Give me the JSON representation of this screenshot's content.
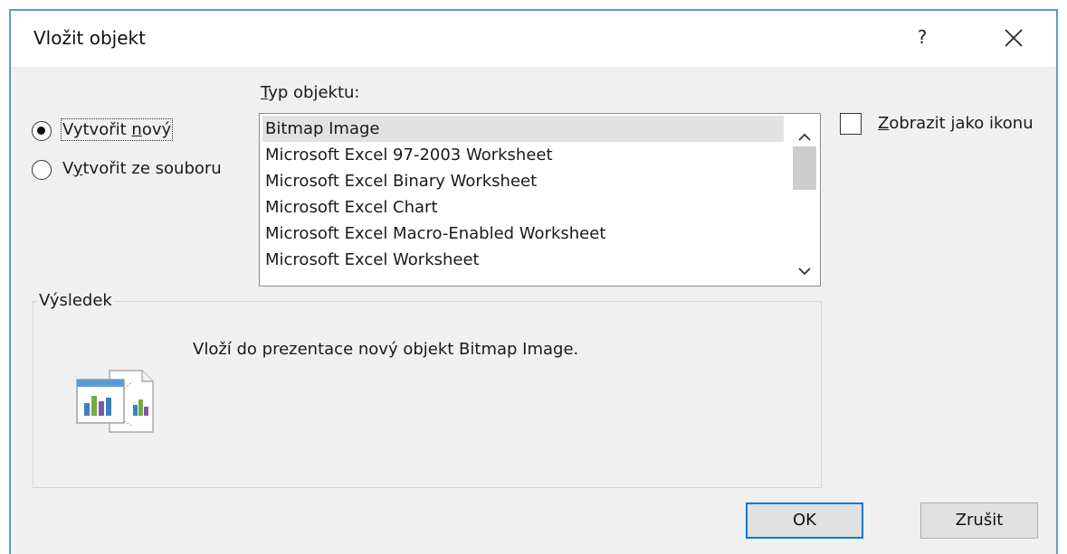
{
  "dialog": {
    "title": "Vložit objekt",
    "help_label": "?",
    "close_icon": "close-icon"
  },
  "source_options": [
    {
      "label_pre": "Vytvořit ",
      "label_key": "n",
      "label_post": "ový",
      "selected": true
    },
    {
      "label_pre": "V",
      "label_key": "y",
      "label_post": "tvořit ze souboru",
      "selected": false
    }
  ],
  "object_type": {
    "label_key": "T",
    "label_rest": "yp objektu:",
    "items": [
      "Bitmap Image",
      "Microsoft Excel 97-2003 Worksheet",
      "Microsoft Excel Binary Worksheet",
      "Microsoft Excel Chart",
      "Microsoft Excel Macro-Enabled Worksheet",
      "Microsoft Excel Worksheet"
    ],
    "selected_index": 0
  },
  "display_as_icon": {
    "label_key": "Z",
    "label_rest": "obrazit jako ikonu",
    "checked": false
  },
  "result": {
    "legend": "Výsledek",
    "text": "Vloží do prezentace nový objekt Bitmap Image.",
    "icon": "embedded-object-icon"
  },
  "buttons": {
    "ok": "OK",
    "cancel": "Zrušit"
  },
  "colors": {
    "accent": "#0078d7",
    "window_border": "#5b9bd5",
    "dialog_bg": "#f0f0f0",
    "selection_bg": "#e2e2e2"
  }
}
